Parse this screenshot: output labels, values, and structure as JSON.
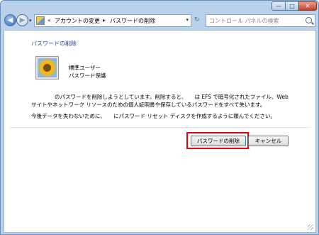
{
  "window": {
    "min_glyph": "—",
    "max_glyph": "□",
    "close_glyph": "✕"
  },
  "nav": {
    "back_glyph": "◀",
    "forward_glyph": "▶",
    "dropdown_glyph": "▾",
    "refresh_glyph": "↻"
  },
  "address": {
    "lead_chevron": "«",
    "crumb1": "アカウントの変更",
    "sep_chevron": "▸",
    "crumb2": "パスワードの削除",
    "dropdown_glyph": "▾"
  },
  "search": {
    "placeholder": "コントロール パネルの検索"
  },
  "page": {
    "heading": "パスワードの削除",
    "user_type": "標準ユーザー",
    "user_status": "パスワード保護",
    "msg_line1": "のパスワードを削除しようとしています。削除すると、　　は EFS で暗号化されたファイル、Web",
    "msg_line2": "サイトやネットワーク リソースのための個人証明書や保存しているパスワードをすべて失います。",
    "msg_line3": "今後データを失わないために、　　にパスワード リセット ディスクを作成するように頼んでください。"
  },
  "buttons": {
    "delete_label": "パスワードの削除",
    "cancel_label": "キャンセル"
  },
  "colors": {
    "heading": "#1e4a96",
    "highlight": "#e3000f",
    "frame": "#b9d1ea"
  },
  "icons": {
    "avatar": "sunflower-avatar",
    "search": "search-icon",
    "address": "control-panel-icon"
  }
}
